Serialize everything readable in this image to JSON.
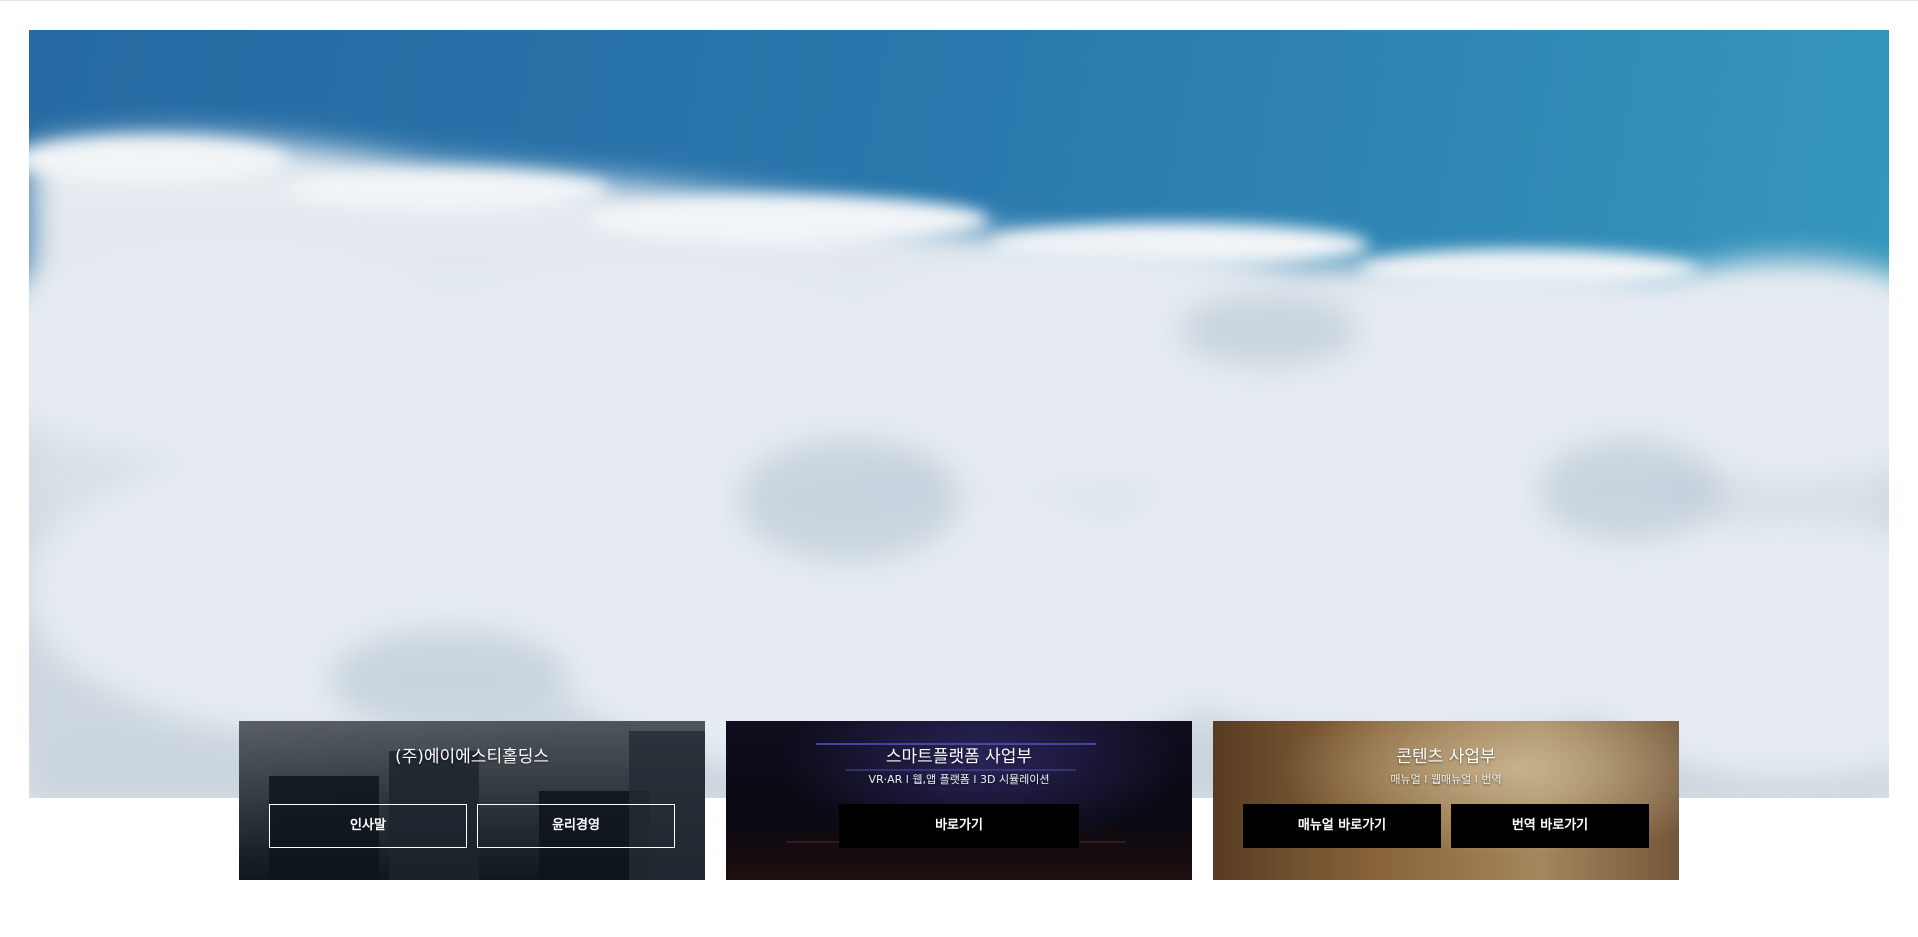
{
  "hero": {
    "image_icon": "clouds-sky-photo"
  },
  "cards": [
    {
      "title": "(주)에이에스티홀딩스",
      "buttons": [
        {
          "label": "인사말"
        },
        {
          "label": "윤리경영"
        }
      ]
    },
    {
      "title": "스마트플랫폼 사업부",
      "subtitle": "VR·AR l 웹,앱 플랫폼 l 3D 시뮬레이션",
      "buttons": [
        {
          "label": "바로가기"
        }
      ]
    },
    {
      "title": "콘텐츠 사업부",
      "subtitle": "매뉴얼 l 웹매뉴얼 l 번역",
      "buttons": [
        {
          "label": "매뉴얼 바로가기"
        },
        {
          "label": "번역 바로가기"
        }
      ]
    }
  ],
  "colors": {
    "sky": "#2a75ab",
    "button_solid": "#000000",
    "button_outline": "#ffffff"
  }
}
